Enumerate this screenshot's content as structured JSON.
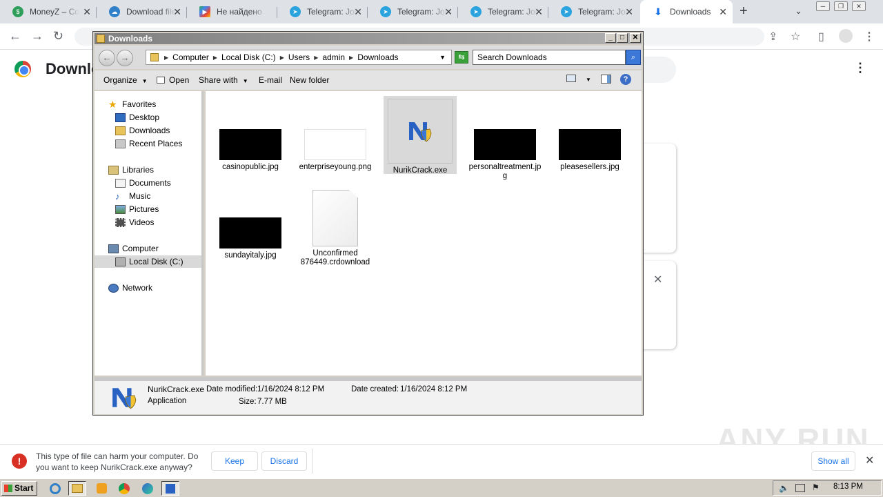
{
  "browser": {
    "tabs": [
      {
        "title": "MoneyZ – Co",
        "icon": "moneyz-icon",
        "color": "#2f9e5b"
      },
      {
        "title": "Download file",
        "icon": "cloud-download-icon",
        "color": "#2f80c8"
      },
      {
        "title": "Не найдено",
        "icon": "google-play-icon",
        "color": "#3c8cf0"
      },
      {
        "title": "Telegram: Join",
        "icon": "telegram-icon",
        "color": "#2aa3df"
      },
      {
        "title": "Telegram: Join",
        "icon": "telegram-icon",
        "color": "#2aa3df"
      },
      {
        "title": "Telegram: Join",
        "icon": "telegram-icon",
        "color": "#2aa3df"
      },
      {
        "title": "Telegram: Join",
        "icon": "telegram-icon",
        "color": "#2aa3df"
      },
      {
        "title": "Downloads",
        "icon": "download-icon",
        "color": "#1a73e8"
      }
    ],
    "page_title": "Downloads"
  },
  "explorer": {
    "title": "Downloads",
    "breadcrumb": [
      "Computer",
      "Local Disk (C:)",
      "Users",
      "admin",
      "Downloads"
    ],
    "search_placeholder": "Search Downloads",
    "commands": {
      "organize": "Organize",
      "open": "Open",
      "share_with": "Share with",
      "email": "E-mail",
      "new_folder": "New folder"
    },
    "nav": {
      "favorites": "Favorites",
      "desktop": "Desktop",
      "downloads": "Downloads",
      "recent_places": "Recent Places",
      "libraries": "Libraries",
      "documents": "Documents",
      "music": "Music",
      "pictures": "Pictures",
      "videos": "Videos",
      "computer": "Computer",
      "local_disk": "Local Disk (C:)",
      "network": "Network"
    },
    "files": [
      {
        "name": "casinopublic.jpg",
        "kind": "black-image"
      },
      {
        "name": "enterpriseyoung.png",
        "kind": "white-image"
      },
      {
        "name": "NurikCrack.exe",
        "kind": "exe"
      },
      {
        "name": "personaltreatment.jpg",
        "kind": "black-image"
      },
      {
        "name": "pleasesellers.jpg",
        "kind": "black-image"
      },
      {
        "name": "sundayitaly.jpg",
        "kind": "black-image"
      },
      {
        "name": "Unconfirmed 876449.crdownload",
        "kind": "document"
      }
    ],
    "details": {
      "name": "NurikCrack.exe",
      "type": "Application",
      "modified_label": "Date modified:",
      "modified": "1/16/2024 8:12 PM",
      "created_label": "Date created:",
      "created": "1/16/2024 8:12 PM",
      "size_label": "Size:",
      "size": "7.77 MB"
    }
  },
  "download_bar": {
    "message": "This type of file can harm your computer. Do you want to keep NurikCrack.exe anyway?",
    "keep": "Keep",
    "discard": "Discard",
    "show_all": "Show all"
  },
  "watermark": "ANY RUN",
  "taskbar": {
    "start": "Start",
    "clock": "8:13 PM"
  }
}
